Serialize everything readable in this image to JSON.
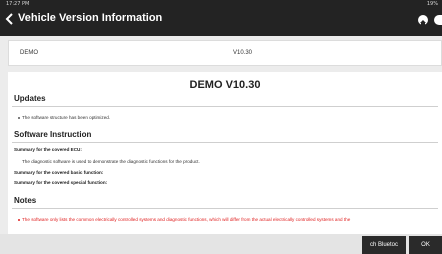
{
  "status_bar": {
    "time": "17:27 PM",
    "battery": "19%"
  },
  "header": {
    "title": "Vehicle Version Information"
  },
  "version_row": {
    "name": "DEMO",
    "version": "V10.30"
  },
  "document": {
    "title": "DEMO V10.30",
    "updates": {
      "heading": "Updates",
      "items": [
        "The software structure has been optimized."
      ]
    },
    "software_instruction": {
      "heading": "Software Instruction",
      "ecu_label": "Summary for the covered ECU:",
      "ecu_text": "The diagnostic software is used to demonstrate the diagnostic functions for the product.",
      "basic_label": "Summary for the covered basic function:",
      "special_label": "Summary for the covered special function:"
    },
    "notes": {
      "heading": "Notes",
      "items": [
        "The software only lists the common electrically controlled systems and diagnostic functions, which will differ from the actual electrically controlled systems and the"
      ]
    }
  },
  "buttons": {
    "bluetooth": "ch Bluetoc",
    "ok": "OK"
  },
  "colors": {
    "topbar": "#232323",
    "note_text": "#e02020"
  },
  "icons": [
    "back-arrow-icon",
    "home-icon",
    "more-icon"
  ]
}
